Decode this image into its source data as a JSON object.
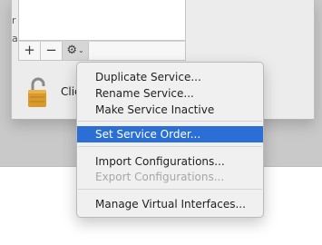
{
  "window": {
    "left_edge_labels": [
      "r",
      "ar"
    ],
    "lock_label_partial": "Clic"
  },
  "toolbar": {
    "add_label": "+",
    "remove_label": "−",
    "gear_label": "⚙",
    "chevron_label": "⌄"
  },
  "menu": {
    "items": [
      {
        "label": "Duplicate Service...",
        "enabled": true
      },
      {
        "label": "Rename Service...",
        "enabled": true
      },
      {
        "label": "Make Service Inactive",
        "enabled": true
      },
      {
        "label": "Set Service Order...",
        "enabled": true,
        "selected": true
      },
      {
        "label": "Import Configurations...",
        "enabled": true
      },
      {
        "label": "Export Configurations...",
        "enabled": false
      },
      {
        "label": "Manage Virtual Interfaces...",
        "enabled": true
      }
    ]
  },
  "colors": {
    "selection": "#2b6fd6",
    "lock": "#d89a2b"
  }
}
